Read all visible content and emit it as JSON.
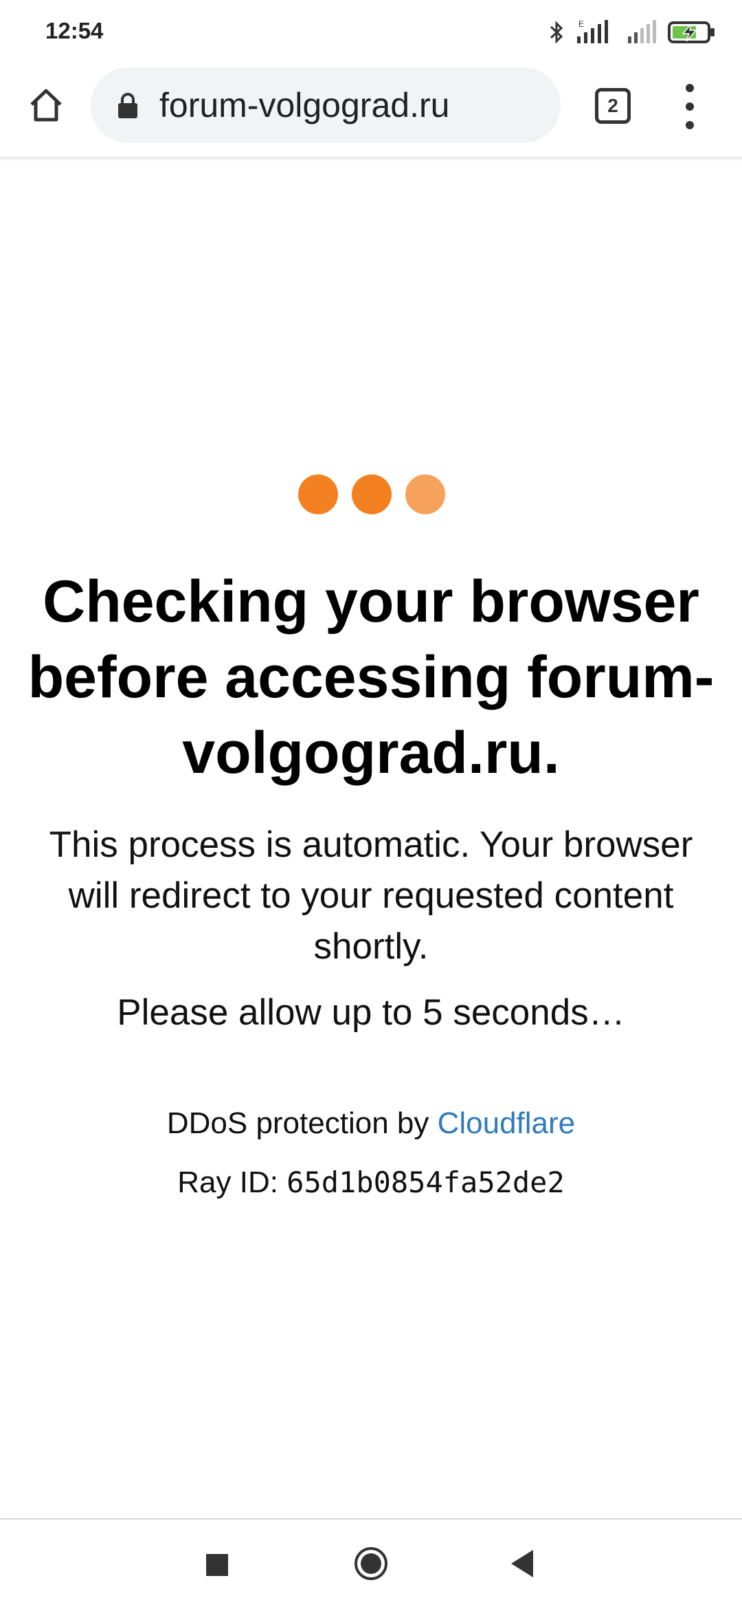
{
  "status_bar": {
    "time": "12:54",
    "icons": [
      "bluetooth-icon",
      "signal-icon-sim1",
      "signal-icon-sim2",
      "battery-charging-icon"
    ],
    "network_label": "E"
  },
  "toolbar": {
    "url": "forum-volgograd.ru",
    "tab_count": "2",
    "icons": [
      "home-icon",
      "lock-icon",
      "tab-switcher-icon",
      "more-vert-icon"
    ]
  },
  "page": {
    "loading_dots_colors": [
      "#f38020",
      "#f38020",
      "#f6a25c"
    ],
    "heading": "Checking your browser before accessing forum-volgograd.ru.",
    "description": "This process is automatic. Your browser will redirect to your requested content shortly.",
    "wait_text": "Please allow up to 5 seconds…",
    "ddos_prefix": "DDoS protection by ",
    "ddos_link": "Cloudflare",
    "ray_label": "Ray ID: ",
    "ray_id": "65d1b0854fa52de2"
  },
  "nav_bar": {
    "icons": [
      "recents-square-icon",
      "home-circle-icon",
      "back-triangle-icon"
    ]
  },
  "colors": {
    "accent_orange": "#f38020",
    "link_blue": "#2f7bbf",
    "url_bar_bg": "#f1f3f4"
  }
}
